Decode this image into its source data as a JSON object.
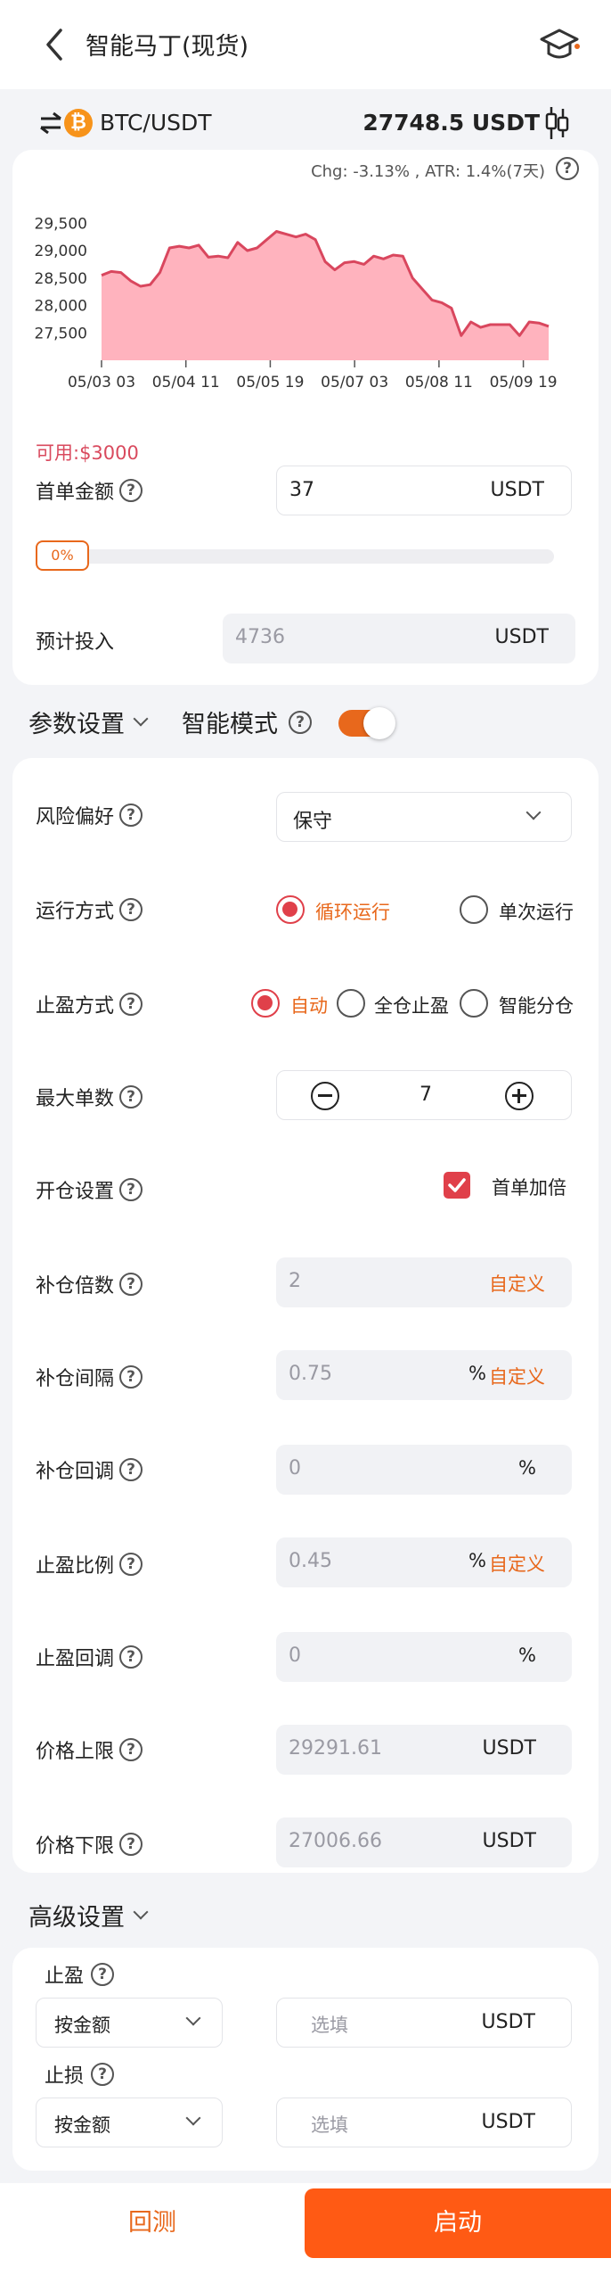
{
  "header": {
    "title": "智能马丁(现货)",
    "back_icon": "back-arrow-icon",
    "guide_icon": "graduation-cap-icon"
  },
  "ticker": {
    "pair": "BTC/USDT",
    "price": "27748.5 USDT",
    "stats": "Chg: -3.13% , ATR: 1.4%(7天)"
  },
  "chart_data": {
    "type": "area",
    "ylim": [
      27000,
      29700
    ],
    "yticks": [
      "29,500",
      "29,000",
      "28,500",
      "28,000",
      "27,500"
    ],
    "ytick_values": [
      29500,
      29000,
      28500,
      28000,
      27500
    ],
    "xticks": [
      "05/03 03",
      "05/04 11",
      "05/05 19",
      "05/07 03",
      "05/08 11",
      "05/09 19"
    ],
    "xtick_positions": [
      0,
      1,
      2,
      3,
      4,
      5
    ],
    "series": [
      {
        "values": [
          28550,
          28620,
          28600,
          28450,
          28350,
          28380,
          28600,
          29050,
          29080,
          29050,
          29100,
          28880,
          28900,
          28870,
          29150,
          29000,
          29050,
          29200,
          29350,
          29300,
          29250,
          29300,
          29200,
          28800,
          28650,
          28780,
          28800,
          28750,
          28900,
          28850,
          28920,
          28900,
          28500,
          28300,
          28100,
          28050,
          27950,
          27450,
          27700,
          27600,
          27650,
          27650,
          27650,
          27450,
          27700,
          27680,
          27620
        ]
      }
    ],
    "x_span": [
      0,
      5.3
    ],
    "colors": {
      "line": "#d9475e",
      "fill": "#ffb3be"
    }
  },
  "invest": {
    "available": "可用:$3000",
    "first_amount_label": "首单金额",
    "first_amount_value": "37",
    "unit": "USDT",
    "slider_value": "0%",
    "slider_fraction": 0,
    "estimate_label": "预计投入",
    "estimate_value": "4736"
  },
  "params": {
    "section_label": "参数设置",
    "smart_mode_label": "智能模式",
    "smart_mode_on": true,
    "risk_label": "风险偏好",
    "risk_value": "保守",
    "run_label": "运行方式",
    "run_options": [
      "循环运行",
      "单次运行"
    ],
    "tp_mode_label": "止盈方式",
    "tp_mode_options": [
      "自动",
      "全仓止盈",
      "智能分仓"
    ],
    "max_orders_label": "最大单数",
    "max_orders_value": "7",
    "open_label": "开仓设置",
    "open_check_label": "首单加倍",
    "add_mult_label": "补仓倍数",
    "add_mult_value": "2",
    "custom_label": "自定义",
    "add_gap_label": "补仓间隔",
    "add_gap_value": "0.75",
    "add_pullback_label": "补仓回调",
    "add_pullback_value": "0",
    "tp_ratio_label": "止盈比例",
    "tp_ratio_value": "0.45",
    "tp_pullback_label": "止盈回调",
    "tp_pullback_value": "0",
    "percent": "%",
    "upper_label": "价格上限",
    "upper_value": "29291.61",
    "lower_label": "价格下限",
    "lower_value": "27006.66",
    "unit": "USDT"
  },
  "advanced": {
    "section_label": "高级设置",
    "tp_label": "止盈",
    "sl_label": "止损",
    "mode_value": "按金额",
    "placeholder": "选填",
    "unit": "USDT"
  },
  "footer": {
    "backtest_label": "回测",
    "start_label": "启动"
  }
}
